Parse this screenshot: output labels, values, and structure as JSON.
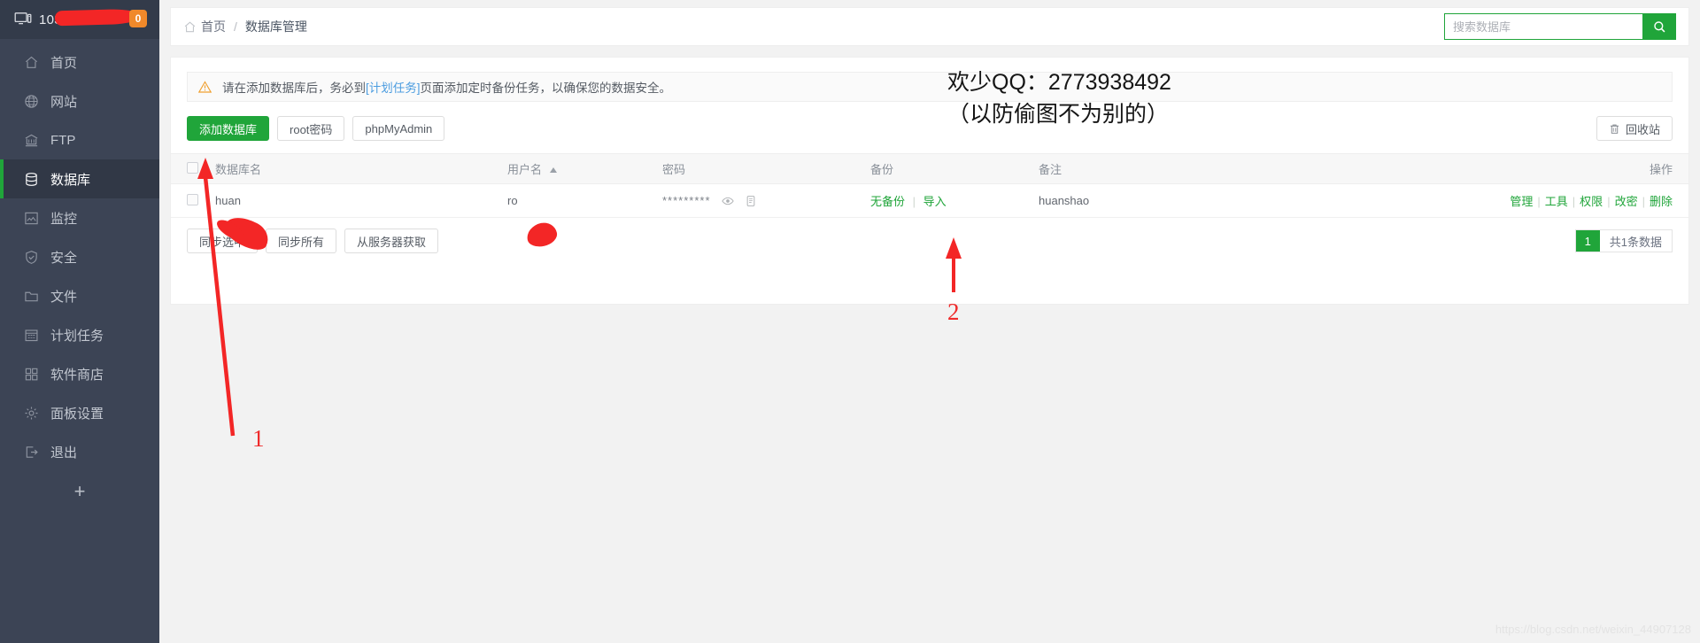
{
  "sidebar": {
    "host_ip": "103.",
    "badge_count": "0",
    "add_label": "+",
    "items": [
      {
        "label": "首页",
        "icon": "home-icon",
        "active": false
      },
      {
        "label": "网站",
        "icon": "globe-icon",
        "active": false
      },
      {
        "label": "FTP",
        "icon": "ftp-icon",
        "active": false
      },
      {
        "label": "数据库",
        "icon": "database-icon",
        "active": true
      },
      {
        "label": "监控",
        "icon": "chart-icon",
        "active": false
      },
      {
        "label": "安全",
        "icon": "shield-icon",
        "active": false
      },
      {
        "label": "文件",
        "icon": "folder-icon",
        "active": false
      },
      {
        "label": "计划任务",
        "icon": "calendar-icon",
        "active": false
      },
      {
        "label": "软件商店",
        "icon": "grid-icon",
        "active": false
      },
      {
        "label": "面板设置",
        "icon": "gear-icon",
        "active": false
      },
      {
        "label": "退出",
        "icon": "logout-icon",
        "active": false
      }
    ]
  },
  "header": {
    "breadcrumb_home": "首页",
    "breadcrumb_sep": "/",
    "breadcrumb_current": "数据库管理",
    "search_placeholder": "搜索数据库",
    "search_value": ""
  },
  "alert": {
    "text_before": "请在添加数据库后，务必到",
    "link": "[计划任务]",
    "text_after": "页面添加定时备份任务，以确保您的数据安全。"
  },
  "toolbar": {
    "add_db_label": "添加数据库",
    "root_pwd_label": "root密码",
    "phpmyadmin_label": "phpMyAdmin",
    "recycle_label": "回收站"
  },
  "table": {
    "columns": [
      "数据库名",
      "用户名",
      "密码",
      "备份",
      "备注",
      "操作"
    ],
    "sort_column": "用户名",
    "rows": [
      {
        "db_name": "huan",
        "user_name": "ro",
        "password_mask": "*********",
        "backup_status": "无备份",
        "backup_import": "导入",
        "note": "huanshao",
        "actions": [
          "管理",
          "工具",
          "权限",
          "改密",
          "删除"
        ]
      }
    ]
  },
  "footer": {
    "sync_selected_label": "同步选中",
    "sync_all_label": "同步所有",
    "fetch_from_server_label": "从服务器获取",
    "page_number": "1",
    "total_text": "共1条数据"
  },
  "annotations": {
    "qq_line1": "欢少QQ：2773938492",
    "qq_line2": "（以防偷图不为别的）",
    "marker_1": "1",
    "marker_2": "2",
    "watermark": "https://blog.csdn.net/weixin_44907128"
  },
  "colors": {
    "accent_green": "#20a53a",
    "sidebar_bg": "#3c4455",
    "badge_orange": "#f0892a",
    "warn_orange": "#f0a030",
    "annotation_red": "#ef2b2b",
    "link_blue": "#4d9de0"
  }
}
